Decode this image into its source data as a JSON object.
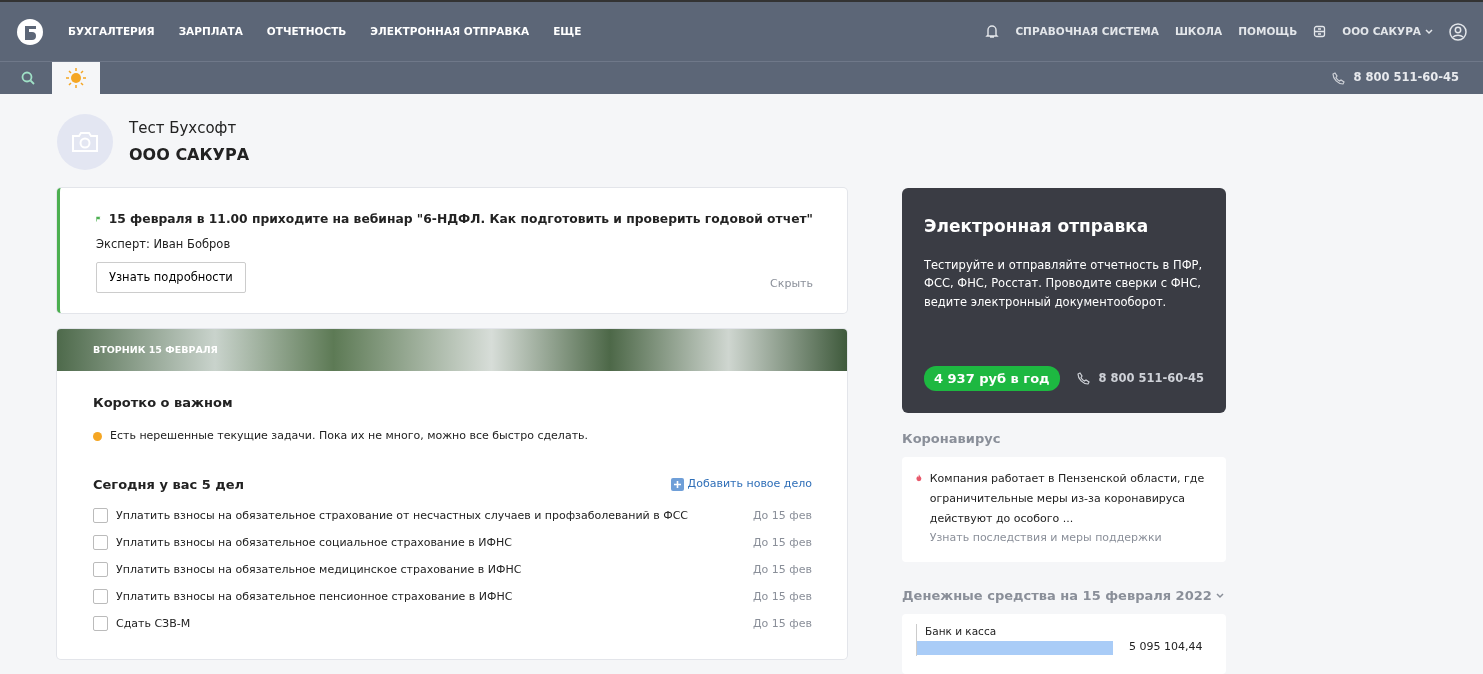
{
  "nav": {
    "items": [
      "БУХГАЛТЕРИЯ",
      "ЗАРПЛАТА",
      "ОТЧЕТНОСТЬ",
      "ЭЛЕКТРОННАЯ ОТПРАВКА",
      "ЕЩЕ"
    ],
    "right_items": [
      "СПРАВОЧНАЯ СИСТЕМА",
      "ШКОЛА",
      "ПОМОЩЬ"
    ],
    "account": "ООО САКУРА"
  },
  "subbar": {
    "tabs": [
      {
        "kind": "search",
        "selected": false
      },
      {
        "kind": "sun",
        "selected": true
      }
    ],
    "phone": "8 800 511-60-45"
  },
  "profile": {
    "user": "Тест Бухсофт",
    "company": "ООО САКУРА"
  },
  "webinar": {
    "title": "15 февраля в 11.00 приходите на вебинар \"6-НДФЛ. Как подготовить и проверить годовой отчет\"",
    "expert": "Эксперт: Иван Бобров",
    "button": "Узнать подробности",
    "hide": "Скрыть"
  },
  "day": {
    "date": "ВТОРНИК 15 ФЕВРАЛЯ",
    "brief_title": "Коротко о важном",
    "notices": [
      {
        "text": "Есть нерешенные текущие задачи. Пока их не много, можно все быстро сделать.",
        "color": "#f5a623"
      }
    ],
    "tasks_title": "Сегодня у вас 5 дел",
    "add": "Добавить новое дело",
    "tasks": [
      {
        "text": "Уплатить взносы на обязательное страхование от несчастных случаев и профзаболеваний в ФСС",
        "due": "До 15 фев",
        "checked": false
      },
      {
        "text": "Уплатить взносы на обязательное социальное страхование в ИФНС",
        "due": "До 15 фев",
        "checked": false
      },
      {
        "text": "Уплатить взносы на обязательное медицинское страхование в ИФНС",
        "due": "До 15 фев",
        "checked": false
      },
      {
        "text": "Уплатить взносы на обязательное пенсионное страхование в ИФНС",
        "due": "До 15 фев",
        "checked": false
      },
      {
        "text": "Сдать СЗВ-М",
        "due": "До 15 фев",
        "checked": false
      }
    ]
  },
  "promo": {
    "title": "Электронная отправка",
    "text": "Тестируйте и отправляйте отчетность в ПФР, ФСС, ФНС, Росстат. Проводите сверки с ФНС, ведите электронный документооборот.",
    "price": "4 937 руб в год",
    "phone": "8 800 511-60-45"
  },
  "corona": {
    "heading": "Коронавирус",
    "text": "Компания работает в Пензенской области, где ограничительные меры из-за коронавируса действуют до особого ...",
    "link": "Узнать последствия и меры поддержки"
  },
  "cash": {
    "heading": "Денежные средства на 15 февраля 2022",
    "items": [
      {
        "label": "Банк и касса",
        "amount": "5 095 104,44"
      }
    ]
  }
}
